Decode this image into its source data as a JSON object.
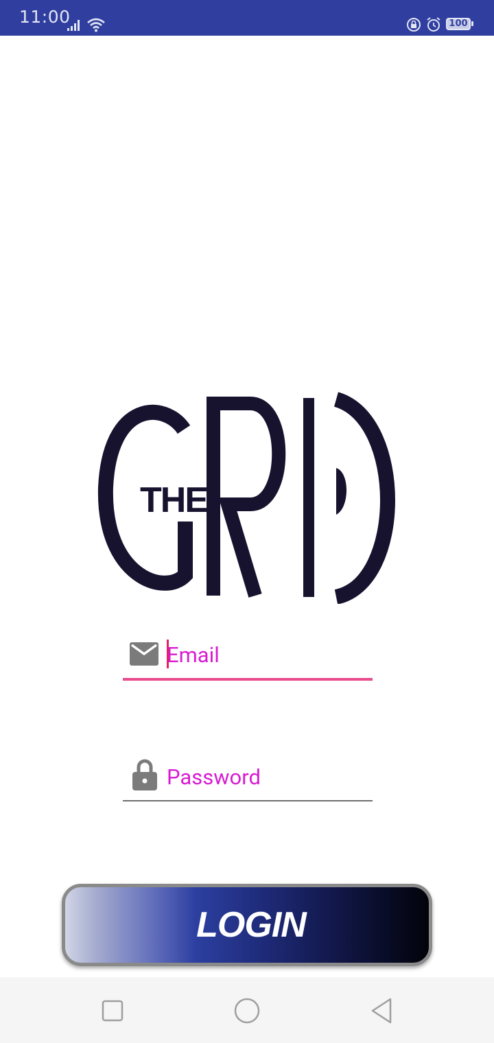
{
  "status_bar": {
    "time": "11:00",
    "battery": "100",
    "icons": [
      "signal-icon",
      "wifi-icon",
      "rotation-lock-icon",
      "alarm-icon",
      "battery-icon"
    ]
  },
  "logo": {
    "text_small": "THE",
    "text_large": "GRID",
    "color": "#17132f"
  },
  "form": {
    "email": {
      "placeholder": "Email",
      "value": "",
      "icon": "email-icon"
    },
    "password": {
      "placeholder": "Password",
      "value": "",
      "icon": "lock-icon"
    }
  },
  "login_button": {
    "label": "LOGIN"
  },
  "nav_bar": {
    "items": [
      "recents-button",
      "home-button",
      "back-button"
    ]
  },
  "colors": {
    "status_bar": "#303f9f",
    "accent_text": "#d81bd2",
    "focus_underline": "#e84c8c",
    "logo": "#17132f"
  }
}
